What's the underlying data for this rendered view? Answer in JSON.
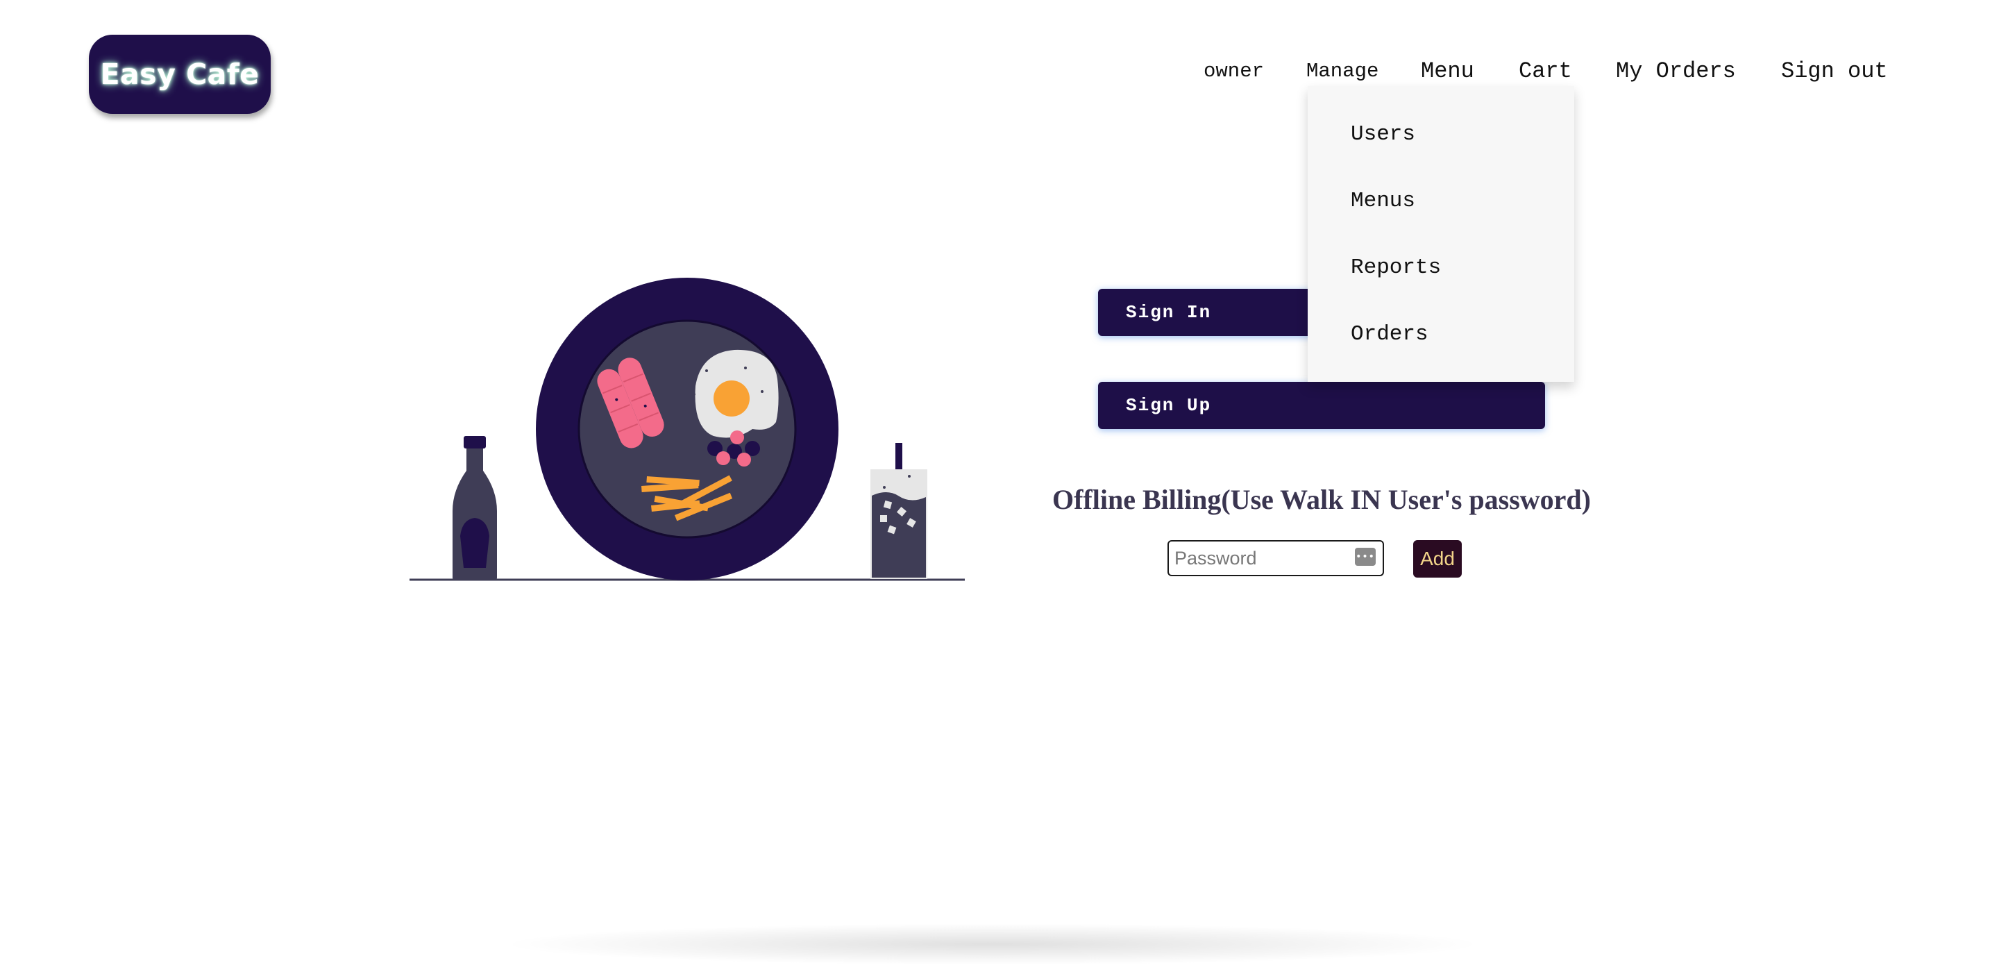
{
  "header": {
    "logo_text": "Easy Cafe",
    "nav": {
      "owner": "owner",
      "manage": "Manage",
      "menu": "Menu",
      "cart": "Cart",
      "my_orders": "My Orders",
      "sign_out": "Sign out"
    }
  },
  "manage_dropdown": {
    "items": [
      "Users",
      "Menus",
      "Reports",
      "Orders"
    ]
  },
  "auth": {
    "sign_in_label": "Sign In",
    "sign_up_label": "Sign Up"
  },
  "billing": {
    "title": "Offline Billing(Use Walk IN User's password)",
    "password_placeholder": "Password",
    "password_value": "",
    "add_label": "Add"
  },
  "colors": {
    "brand_dark": "#1f0f4a",
    "add_button_bg": "#2a0b22",
    "add_button_text": "#f3d58a",
    "button_glow": "#508ce6"
  },
  "icons": {
    "password_manager": "key-icon",
    "illustration": "breakfast-plate-illustration"
  }
}
